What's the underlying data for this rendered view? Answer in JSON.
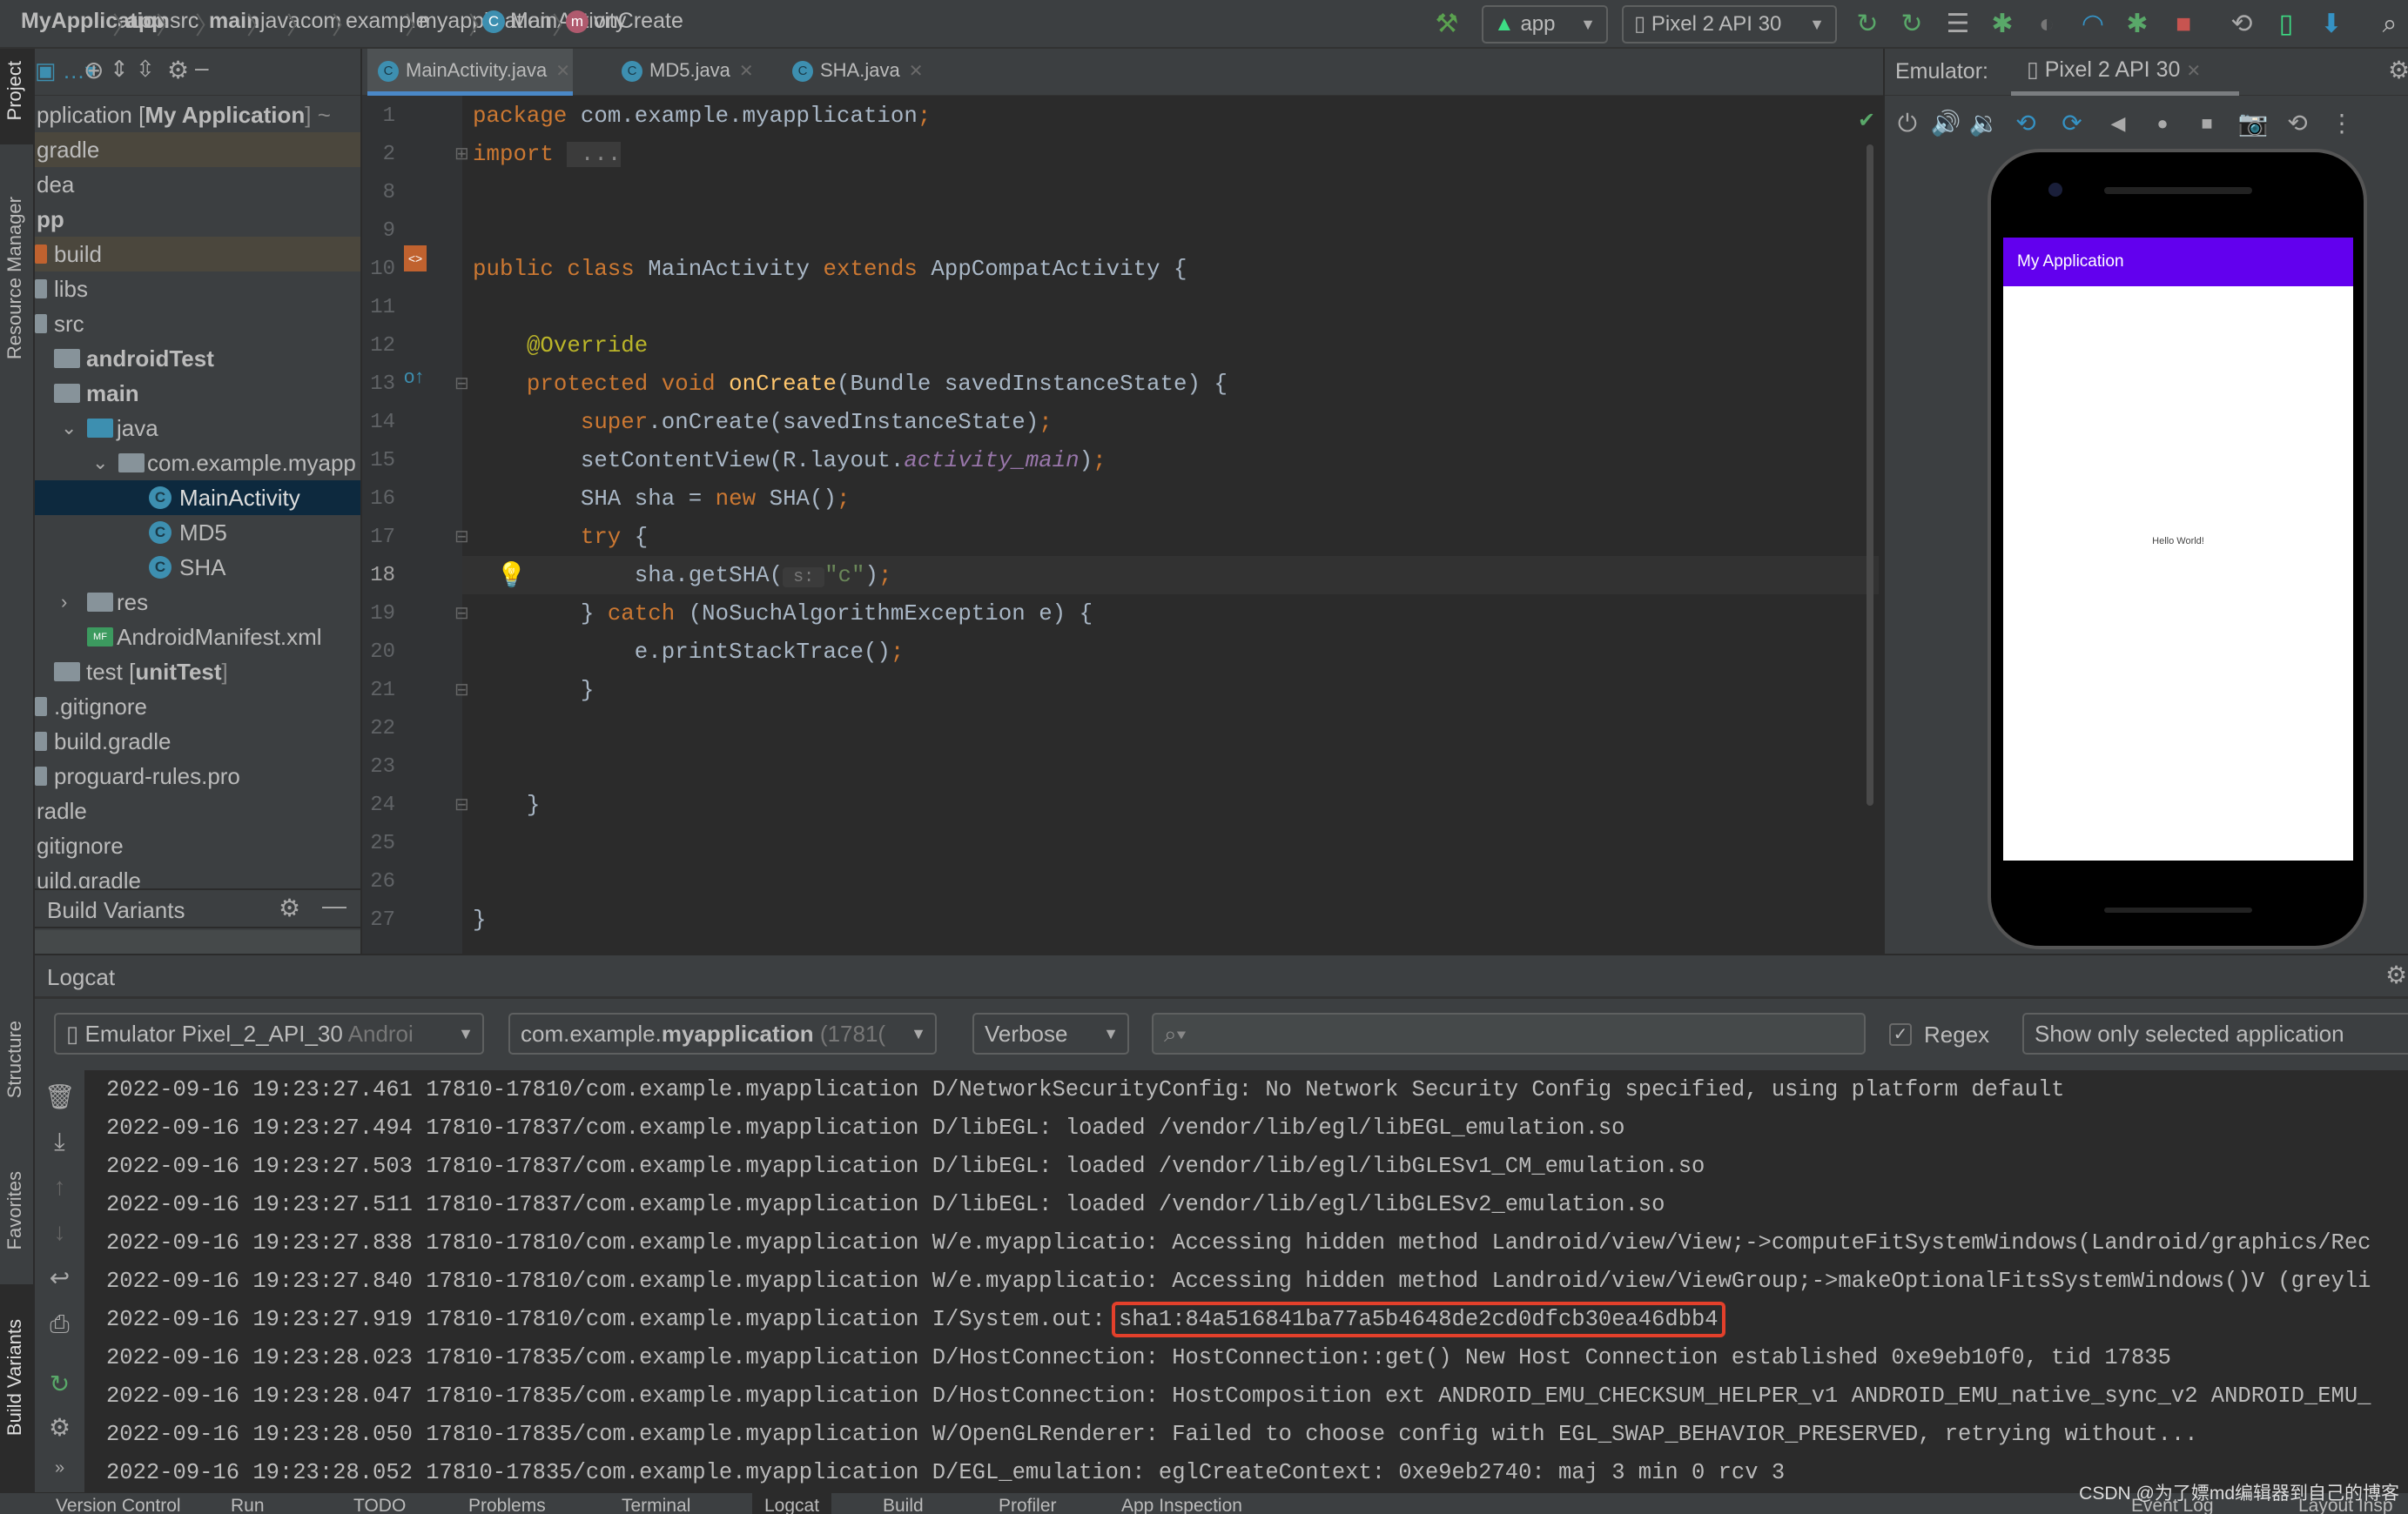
{
  "navbar": {
    "breadcrumbs": [
      {
        "label": "MyApplication",
        "bold": true
      },
      {
        "label": "app",
        "bold": true
      },
      {
        "label": "src",
        "bold": false
      },
      {
        "label": "main",
        "bold": true
      },
      {
        "label": "java",
        "bold": false
      },
      {
        "label": "com",
        "bold": false
      },
      {
        "label": "example",
        "bold": false
      },
      {
        "label": "myapplication",
        "bold": false
      },
      {
        "label": "MainActivity",
        "bold": false,
        "icon": "C"
      },
      {
        "label": "onCreate",
        "bold": false,
        "icon": "m"
      }
    ],
    "run_config": "app",
    "device": "Pixel 2 API 30"
  },
  "left_strip": {
    "tabs": [
      "Project",
      "Resource Manager",
      "Structure",
      "Favorites",
      "Build Variants"
    ]
  },
  "project": {
    "tree": [
      {
        "label": "pplication [",
        "bold_part": "My Application",
        "suffix": "] ~",
        "depth": 0,
        "state": ""
      },
      {
        "label": "gradle",
        "depth": 0,
        "state": "hl"
      },
      {
        "label": "dea",
        "depth": 0,
        "state": ""
      },
      {
        "label": "pp",
        "depth": 0,
        "state": "",
        "bold": true
      },
      {
        "label": "build",
        "depth": 1,
        "state": "hl",
        "icon": "folder-orange"
      },
      {
        "label": "libs",
        "depth": 1,
        "state": "",
        "icon": "folder"
      },
      {
        "label": "src",
        "depth": 1,
        "state": "",
        "icon": "folder"
      },
      {
        "label": "androidTest",
        "depth": 2,
        "state": "",
        "bold": true,
        "icon": "folder-source"
      },
      {
        "label": "main",
        "depth": 2,
        "state": "",
        "bold": true,
        "icon": "folder-source"
      },
      {
        "label": "java",
        "depth": 3,
        "state": "",
        "icon": "folder-blue",
        "chevron": "down"
      },
      {
        "label": "com.example.myapp",
        "depth": 4,
        "state": "",
        "icon": "package",
        "chevron": "down"
      },
      {
        "label": "MainActivity",
        "depth": 5,
        "state": "sel",
        "icon": "class"
      },
      {
        "label": "MD5",
        "depth": 5,
        "state": "",
        "icon": "class"
      },
      {
        "label": "SHA",
        "depth": 5,
        "state": "",
        "icon": "class"
      },
      {
        "label": "res",
        "depth": 3,
        "state": "",
        "icon": "folder-res",
        "chevron": "right"
      },
      {
        "label": "AndroidManifest.xml",
        "depth": 3,
        "state": "",
        "icon": "manifest"
      },
      {
        "label": "test [",
        "bold_part": "unitTest",
        "suffix": "]",
        "depth": 2,
        "state": "",
        "icon": "folder-test"
      },
      {
        "label": ".gitignore",
        "depth": 1,
        "state": "",
        "icon": "file"
      },
      {
        "label": "build.gradle",
        "depth": 1,
        "state": "",
        "icon": "file"
      },
      {
        "label": "proguard-rules.pro",
        "depth": 1,
        "state": "",
        "icon": "file"
      },
      {
        "label": "radle",
        "depth": 0,
        "state": ""
      },
      {
        "label": "gitignore",
        "depth": 0,
        "state": ""
      },
      {
        "label": "uild.gradle",
        "depth": 0,
        "state": ""
      }
    ],
    "build_variants_title": "Build Variants"
  },
  "editor": {
    "tabs": [
      {
        "label": "MainActivity.java",
        "active": true
      },
      {
        "label": "MD5.java",
        "active": false
      },
      {
        "label": "SHA.java",
        "active": false
      }
    ],
    "current_line": 18,
    "lines": [
      {
        "n": "1",
        "t": [
          [
            "package ",
            "kw"
          ],
          [
            "com.example.myapplication",
            "tx"
          ],
          [
            ";",
            "kw"
          ]
        ]
      },
      {
        "n": "2",
        "t": [
          [
            "import ",
            "kw"
          ],
          [
            " ...",
            "fold"
          ]
        ]
      },
      {
        "n": "8",
        "t": []
      },
      {
        "n": "9",
        "t": []
      },
      {
        "n": "10",
        "t": [
          [
            "public class ",
            "kw"
          ],
          [
            "MainActivity ",
            "tx"
          ],
          [
            "extends ",
            "kw"
          ],
          [
            "AppCompatActivity {",
            "tx"
          ]
        ]
      },
      {
        "n": "11",
        "t": []
      },
      {
        "n": "12",
        "t": [
          [
            "    ",
            "tx"
          ],
          [
            "@Override",
            "an"
          ]
        ]
      },
      {
        "n": "13",
        "t": [
          [
            "    protected void ",
            "kw"
          ],
          [
            "onCreate",
            "fn"
          ],
          [
            "(Bundle savedInstanceState) {",
            "tx"
          ]
        ]
      },
      {
        "n": "14",
        "t": [
          [
            "        super",
            "kw"
          ],
          [
            ".onCreate(savedInstanceState)",
            "tx"
          ],
          [
            ";",
            "kw"
          ]
        ]
      },
      {
        "n": "15",
        "t": [
          [
            "        setContentView(R.layout.",
            "tx"
          ],
          [
            "activity_main",
            "pu"
          ],
          [
            ")",
            "tx"
          ],
          [
            ";",
            "kw"
          ]
        ]
      },
      {
        "n": "16",
        "t": [
          [
            "        SHA sha = ",
            "tx"
          ],
          [
            "new ",
            "kw"
          ],
          [
            "SHA()",
            "tx"
          ],
          [
            ";",
            "kw"
          ]
        ]
      },
      {
        "n": "17",
        "t": [
          [
            "        try ",
            "kw"
          ],
          [
            "{",
            "tx"
          ]
        ]
      },
      {
        "n": "18",
        "t": [
          [
            "            sha.getSHA(",
            "tx"
          ],
          [
            " s: ",
            "hint"
          ],
          [
            "\"c\"",
            "st"
          ],
          [
            ")",
            "tx"
          ],
          [
            ";",
            "kw"
          ]
        ]
      },
      {
        "n": "19",
        "t": [
          [
            "        } ",
            "tx"
          ],
          [
            "catch ",
            "kw"
          ],
          [
            "(NoSuchAlgorithmException e) {",
            "tx"
          ]
        ]
      },
      {
        "n": "20",
        "t": [
          [
            "            e.printStackTrace()",
            "tx"
          ],
          [
            ";",
            "kw"
          ]
        ]
      },
      {
        "n": "21",
        "t": [
          [
            "        }",
            "tx"
          ]
        ]
      },
      {
        "n": "22",
        "t": []
      },
      {
        "n": "23",
        "t": []
      },
      {
        "n": "24",
        "t": [
          [
            "    }",
            "tx"
          ]
        ]
      },
      {
        "n": "25",
        "t": []
      },
      {
        "n": "26",
        "t": []
      },
      {
        "n": "27",
        "t": [
          [
            "}",
            "tx"
          ]
        ]
      }
    ]
  },
  "emulator": {
    "label": "Emulator:",
    "tab": "Pixel 2 API 30",
    "toolbar": [
      "power-icon",
      "volume-up-icon",
      "volume-down-icon",
      "rotate-left-icon",
      "rotate-right-icon",
      "back-icon",
      "home-icon",
      "overview-icon",
      "camera-icon",
      "snapshot-icon",
      "more-icon"
    ],
    "app_title": "My Application",
    "app_body": "Hello World!",
    "app_bar_color": "#6200ee"
  },
  "logcat": {
    "title": "Logcat",
    "device_filter": "Emulator Pixel_2_API_30",
    "device_filter_suffix": "Androi",
    "process_prefix": "com.example.",
    "process_bold": "myapplication",
    "process_suffix": "(1781(",
    "level": "Verbose",
    "search_value": "",
    "regex_label": "Regex",
    "regex_checked": true,
    "scope": "Show only selected application",
    "lines": [
      {
        "pre": "2022-09-16 19:23:27.461 17810-17810/com.example.myapplication D/NetworkSecurityConfig: ",
        "msg": "No Network Security Config specified, using platform default",
        "highlight": false
      },
      {
        "pre": "2022-09-16 19:23:27.494 17810-17837/com.example.myapplication D/libEGL: ",
        "msg": "loaded /vendor/lib/egl/libEGL_emulation.so",
        "highlight": false
      },
      {
        "pre": "2022-09-16 19:23:27.503 17810-17837/com.example.myapplication D/libEGL: ",
        "msg": "loaded /vendor/lib/egl/libGLESv1_CM_emulation.so",
        "highlight": false
      },
      {
        "pre": "2022-09-16 19:23:27.511 17810-17837/com.example.myapplication D/libEGL: ",
        "msg": "loaded /vendor/lib/egl/libGLESv2_emulation.so",
        "highlight": false
      },
      {
        "pre": "2022-09-16 19:23:27.838 17810-17810/com.example.myapplication W/e.myapplicatio: ",
        "msg": "Accessing hidden method Landroid/view/View;->computeFitSystemWindows(Landroid/graphics/Rec",
        "highlight": false
      },
      {
        "pre": "2022-09-16 19:23:27.840 17810-17810/com.example.myapplication W/e.myapplicatio: ",
        "msg": "Accessing hidden method Landroid/view/ViewGroup;->makeOptionalFitsSystemWindows()V (greyli",
        "highlight": false
      },
      {
        "pre": "2022-09-16 19:23:27.919 17810-17810/com.example.myapplication I/System.out: ",
        "msg": "sha1:84a516841ba77a5b4648de2cd0dfcb30ea46dbb4",
        "highlight": true
      },
      {
        "pre": "2022-09-16 19:23:28.023 17810-17835/com.example.myapplication D/HostConnection: ",
        "msg": "HostConnection::get() New Host Connection established 0xe9eb10f0, tid 17835",
        "highlight": false
      },
      {
        "pre": "2022-09-16 19:23:28.047 17810-17835/com.example.myapplication D/HostConnection: ",
        "msg": "HostComposition ext ANDROID_EMU_CHECKSUM_HELPER_v1 ANDROID_EMU_native_sync_v2 ANDROID_EMU_",
        "highlight": false
      },
      {
        "pre": "2022-09-16 19:23:28.050 17810-17835/com.example.myapplication W/OpenGLRenderer: ",
        "msg": "Failed to choose config with EGL_SWAP_BEHAVIOR_PRESERVED, retrying without...",
        "highlight": false
      },
      {
        "pre": "2022-09-16 19:23:28.052 17810-17835/com.example.myapplication D/EGL_emulation: ",
        "msg": "eglCreateContext: 0xe9eb2740: maj 3 min 0 rcv 3",
        "highlight": false
      }
    ],
    "highlight_color": "#e3402b"
  },
  "statusbar": {
    "tabs": [
      {
        "label": "Version Control",
        "active": false
      },
      {
        "label": "Run",
        "active": false
      },
      {
        "label": "TODO",
        "active": false
      },
      {
        "label": "Problems",
        "active": false
      },
      {
        "label": "Terminal",
        "active": false
      },
      {
        "label": "Logcat",
        "active": true
      },
      {
        "label": "Build",
        "active": false
      },
      {
        "label": "Profiler",
        "active": false
      },
      {
        "label": "App Inspection",
        "active": false
      }
    ],
    "right_tabs": [
      "Event Log",
      "Layout Insp"
    ],
    "watermark": "CSDN @为了嫖md编辑器到自己的博客"
  }
}
